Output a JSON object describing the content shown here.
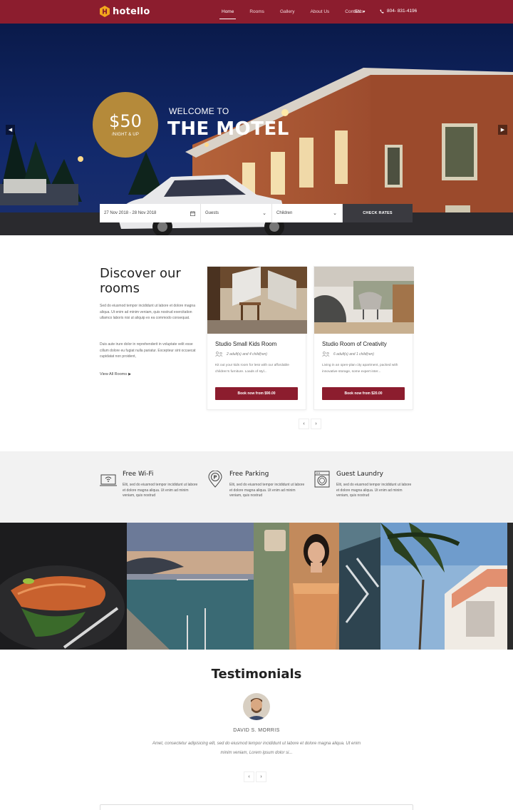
{
  "header": {
    "brand": "hotello",
    "nav": [
      "Home",
      "Rooms",
      "Gallery",
      "About Us",
      "Contacts"
    ],
    "active_nav": "Home",
    "language": "EN",
    "phone": "804- 831-4196",
    "color": "#8c1d2e"
  },
  "hero": {
    "price": "$50",
    "price_note": "/NIGHT & UP",
    "welcome": "WELCOME TO",
    "title": "THE MOTEL",
    "booking": {
      "dates": "27 Nov 2018 - 28 Nov 2018",
      "guests": "Guests",
      "children": "Children",
      "button": "CHECK RATES"
    }
  },
  "rooms": {
    "title": "Discover our rooms",
    "text1": "Sed do eiusmod tempor incididunt ut labore et dolore magna aliqua. Ut enim ad minim veniam, quis nostrud exercitation ullamco laboris nisi ut aliquip ex ea commodo consequat.",
    "text2": "Duis aute irure dolor in reprehenderit in voluptate velit esse cillum dolore eu fugiat nulla pariatur. Excepteur sint occaecat cupidatat non proident,",
    "view_all": "View All Rooms",
    "cards": [
      {
        "name": "Studio Small Kids Room",
        "guests": "2 adult(s) and 4 child(ren)",
        "desc": "Kit out your kids room for less with our affordable children's furniture. Loads of styl...",
        "button": "Book now from $90.00"
      },
      {
        "name": "Studio Room of Creativity",
        "guests": "6 adult(s) and 1 child(ren)",
        "desc": "Living in an open-plan city apartment, packed with innovative storage, some expert inter...",
        "button": "Book now from $20.00"
      }
    ]
  },
  "amenities": [
    {
      "title": "Free Wi-Fi",
      "icon": "wifi-laptop-icon",
      "text": "Elit, sed do eiusmod tempor incididunt ut labore et dolore magna aliqua. Ut enim ad minim veniam, quis nostrud"
    },
    {
      "title": "Free Parking",
      "icon": "parking-pin-icon",
      "text": "Elit, sed do eiusmod tempor incididunt ut labore et dolore magna aliqua. Ut enim ad minim veniam, quis nostrud"
    },
    {
      "title": "Guest Laundry",
      "icon": "washing-machine-icon",
      "text": "Elit, sed do eiusmod tempor incididunt ut labore et dolore magna aliqua. Ut enim ad minim veniam, quis nostrud"
    }
  ],
  "testimonials": {
    "title": "Testimonials",
    "name": "DAVID S. MORRIS",
    "quote": "Amet, consectetur adipisicing elit, sed do eiusmod tempor incididunt ut labore et dolore magna aliqua. Ut enim minim veniam, Lorem ipsum dolor si..."
  }
}
